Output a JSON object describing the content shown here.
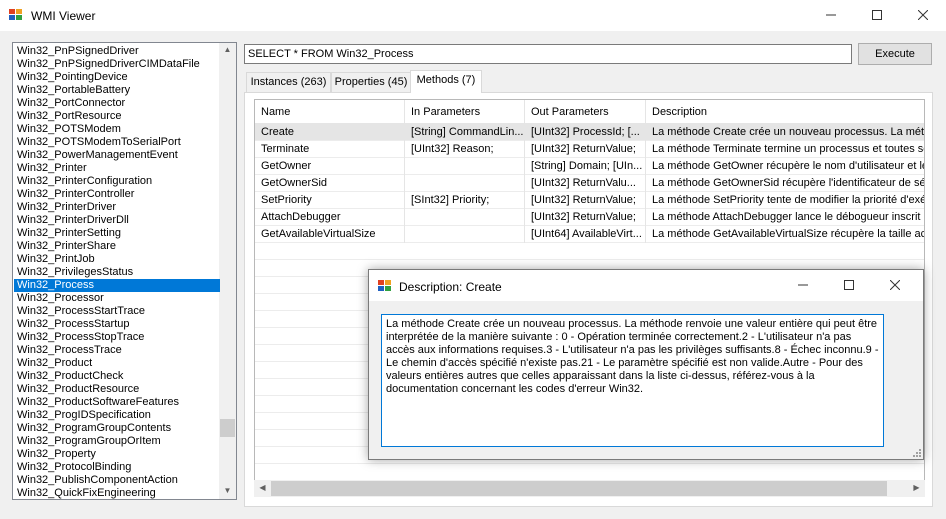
{
  "window": {
    "title": "WMI Viewer",
    "minimize": "—",
    "maximize": "☐",
    "close": "✕"
  },
  "class_list": {
    "items": [
      "Win32_PnPSignedDriver",
      "Win32_PnPSignedDriverCIMDataFile",
      "Win32_PointingDevice",
      "Win32_PortableBattery",
      "Win32_PortConnector",
      "Win32_PortResource",
      "Win32_POTSModem",
      "Win32_POTSModemToSerialPort",
      "Win32_PowerManagementEvent",
      "Win32_Printer",
      "Win32_PrinterConfiguration",
      "Win32_PrinterController",
      "Win32_PrinterDriver",
      "Win32_PrinterDriverDll",
      "Win32_PrinterSetting",
      "Win32_PrinterShare",
      "Win32_PrintJob",
      "Win32_PrivilegesStatus",
      "Win32_Process",
      "Win32_Processor",
      "Win32_ProcessStartTrace",
      "Win32_ProcessStartup",
      "Win32_ProcessStopTrace",
      "Win32_ProcessTrace",
      "Win32_Product",
      "Win32_ProductCheck",
      "Win32_ProductResource",
      "Win32_ProductSoftwareFeatures",
      "Win32_ProgIDSpecification",
      "Win32_ProgramGroupContents",
      "Win32_ProgramGroupOrItem",
      "Win32_Property",
      "Win32_ProtocolBinding",
      "Win32_PublishComponentAction",
      "Win32_QuickFixEngineering"
    ],
    "selected": "Win32_Process"
  },
  "query": {
    "value": "SELECT * FROM Win32_Process",
    "execute_label": "Execute"
  },
  "tabs": [
    {
      "label": "Instances (263)"
    },
    {
      "label": "Properties (45)"
    },
    {
      "label": "Methods (7)"
    }
  ],
  "active_tab": "Methods (7)",
  "methods_grid": {
    "headers": [
      "Name",
      "In Parameters",
      "Out Parameters",
      "Description"
    ],
    "rows": [
      {
        "name": "Create",
        "in": "[String] CommandLin...",
        "out": "[UInt32] ProcessId; [...",
        "desc": "La méthode Create crée un nouveau processus. La méthod"
      },
      {
        "name": "Terminate",
        "in": "[UInt32] Reason;",
        "out": "[UInt32] ReturnValue;",
        "desc": "La méthode Terminate termine un processus et toutes ses"
      },
      {
        "name": "GetOwner",
        "in": "",
        "out": "[String] Domain; [UIn...",
        "desc": "La méthode GetOwner récupère le nom d'utilisateur et le n"
      },
      {
        "name": "GetOwnerSid",
        "in": "",
        "out": "[UInt32] ReturnValu...",
        "desc": "La méthode GetOwnerSid récupère l'identificateur de sécu"
      },
      {
        "name": "SetPriority",
        "in": "[SInt32] Priority;",
        "out": "[UInt32] ReturnValue;",
        "desc": "La méthode SetPriority tente de modifier la priorité d'exécu"
      },
      {
        "name": "AttachDebugger",
        "in": "",
        "out": "[UInt32] ReturnValue;",
        "desc": "La méthode AttachDebugger lance le débogueur inscrit po"
      },
      {
        "name": "GetAvailableVirtualSize",
        "in": "",
        "out": "[UInt64] AvailableVirt...",
        "desc": "La méthode GetAvailableVirtualSize récupère la taille actu"
      }
    ]
  },
  "dialog": {
    "title": "Description: Create",
    "text": "La méthode Create crée un nouveau processus. La méthode renvoie une valeur entière qui peut être interprétée de la manière suivante : 0 - Opération terminée correctement.2 - L'utilisateur n'a pas accès aux informations requises.3 - L'utilisateur n'a pas les privilèges suffisants.8 - Échec inconnu.9 - Le chemin d'accès spécifié n'existe pas.21 - Le paramètre spécifié est non valide.Autre - Pour des valeurs entières autres que celles apparaissant dans la liste ci-dessus, référez-vous à la documentation concernant les codes d'erreur Win32.",
    "minimize": "—",
    "maximize": "☐",
    "close": "✕"
  }
}
